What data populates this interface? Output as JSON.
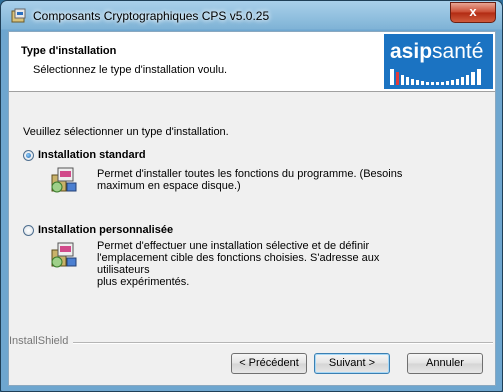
{
  "window": {
    "title": "Composants Cryptographiques CPS v5.0.25",
    "close_label": "x"
  },
  "header": {
    "title": "Type d'installation",
    "subtitle": "Sélectionnez le type d'installation voulu.",
    "logo_text_bold": "asip",
    "logo_text_light": "santé"
  },
  "body": {
    "prompt": "Veuillez sélectionner un type d'installation.",
    "options": [
      {
        "label": "Installation standard",
        "selected": true,
        "description_line1": "Permet d'installer toutes les fonctions du programme. (Besoins",
        "description_line2": "maximum en espace disque.)"
      },
      {
        "label": "Installation personnalisée",
        "selected": false,
        "description_line1": "Permet d'effectuer une installation sélective et de définir",
        "description_line2": "l'emplacement cible des fonctions choisies. S'adresse aux utilisateurs",
        "description_line3": "plus expérimentés."
      }
    ]
  },
  "footer": {
    "brand": "InstallShield",
    "back_label": "< Précédent",
    "next_label": "Suivant >",
    "cancel_label": "Annuler"
  },
  "colors": {
    "logo_bg": "#1b73c2",
    "frame": "#6ea6cf"
  }
}
